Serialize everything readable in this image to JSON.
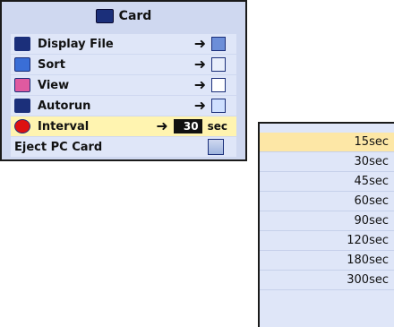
{
  "menu": {
    "title": "Card",
    "items": [
      {
        "label": "Display File",
        "arrow": "➜",
        "icon": "grid-icon",
        "color": "#1b2f7a"
      },
      {
        "label": "Sort",
        "arrow": "➜",
        "icon": "sort-icon",
        "color": "#1b2f7a"
      },
      {
        "label": "View",
        "arrow": "➜",
        "icon": "list-icon",
        "color": "#1b2f7a"
      },
      {
        "label": "Autorun",
        "arrow": "➜",
        "icon": "autorun-icon",
        "color": "#1b2f7a"
      },
      {
        "label": "Interval",
        "arrow": "➜",
        "value": "30",
        "unit": "sec",
        "selected": true,
        "icon": "interval-icon",
        "color": "#d11"
      },
      {
        "label": "Eject PC Card",
        "icon": "pc-card-icon"
      }
    ]
  },
  "dropdown": {
    "options": [
      "15sec",
      "30sec",
      "45sec",
      "60sec",
      "90sec",
      "120sec",
      "180sec",
      "300sec"
    ],
    "selected_index": 0
  }
}
